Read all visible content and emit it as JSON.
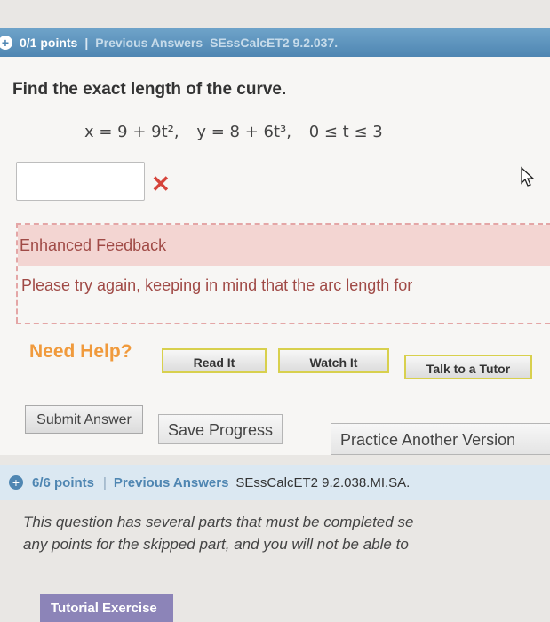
{
  "question1": {
    "points": "0/1 points",
    "divider": "|",
    "previous_answers": "Previous Answers",
    "exercise_id": "SEssCalcET2 9.2.037.",
    "prompt": "Find the exact length of the curve.",
    "equation_x": "x = 9 + 9t²,",
    "equation_y": "y = 8 + 6t³,",
    "equation_range": "0 ≤ t ≤ 3",
    "answer_value": "",
    "status_icon": "x-mark-icon",
    "feedback_title": "Enhanced Feedback",
    "feedback_text": "Please try again, keeping in mind that the arc length for",
    "need_help": "Need Help?",
    "help_buttons": {
      "read": "Read It",
      "watch": "Watch It",
      "tutor": "Talk to a Tutor"
    },
    "actions": {
      "submit": "Submit Answer",
      "save": "Save Progress",
      "practice": "Practice Another Version"
    }
  },
  "question2": {
    "points": "6/6 points",
    "divider": "|",
    "previous_answers": "Previous Answers",
    "exercise_id": "SEssCalcET2 9.2.038.MI.SA.",
    "line1": "This question has several parts that must be completed se",
    "line2": "any points for the skipped part, and you will not be able to",
    "tutorial": "Tutorial Exercise"
  },
  "colors": {
    "header_blue": "#4f86b2",
    "error_red": "#d6443b",
    "feedback_bg": "#f3d5d2",
    "need_help_orange": "#f09a3c",
    "tutorial_purple": "#8c84b8"
  }
}
